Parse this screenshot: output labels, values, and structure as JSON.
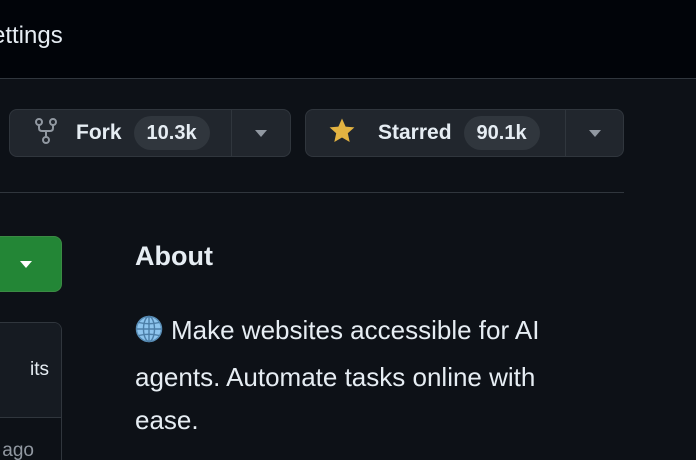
{
  "topbar": {
    "settings_tab": "ettings"
  },
  "actions": {
    "fork": {
      "label": "Fork",
      "count": "10.3k",
      "icon": "repo-forked-icon"
    },
    "star": {
      "label": "Starred",
      "count": "90.1k",
      "icon": "star-fill-icon",
      "icon_color": "#e3b341"
    }
  },
  "left_column": {
    "code_button_color": "#238636",
    "commits_label": "its",
    "last_commit_age": "ago"
  },
  "about": {
    "heading": "About",
    "description": "Make websites accessible for AI agents. Automate tasks online with ease.",
    "description_icon": "globe-icon"
  }
}
